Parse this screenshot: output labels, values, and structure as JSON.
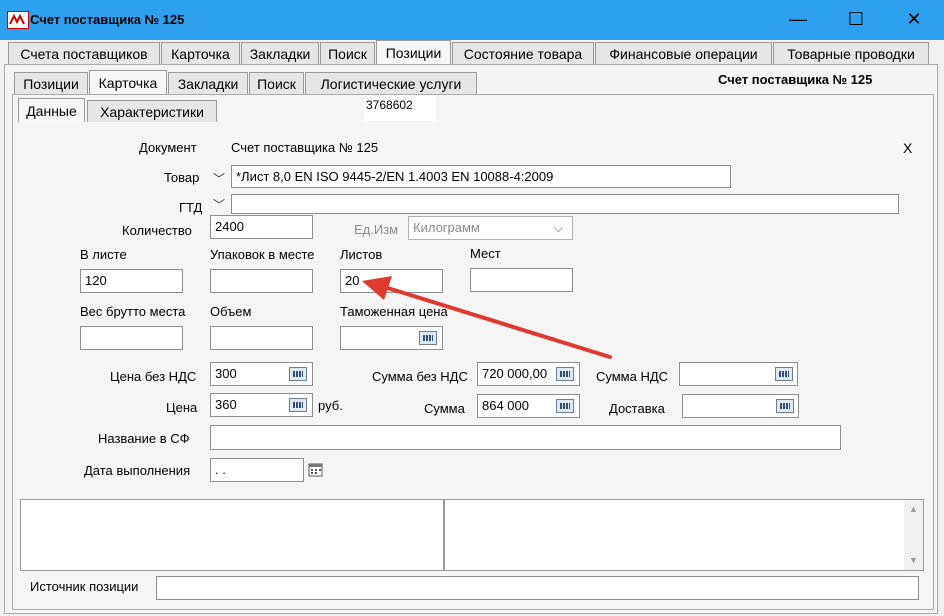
{
  "window": {
    "title": "Счет поставщика № 125",
    "minimize": "—",
    "maximize": "☐",
    "close": "✕"
  },
  "top_tabs": [
    "Счета поставщиков",
    "Карточка",
    "Закладки",
    "Поиск",
    "Позиции",
    "Состояние товара",
    "Финансовые операции",
    "Товарные проводки"
  ],
  "sub_tabs": [
    "Позиции",
    "Карточка",
    "Закладки",
    "Поиск",
    "Логистические услуги"
  ],
  "doc_header": "Счет поставщика № 125",
  "inner_tabs": [
    "Данные",
    "Характеристики"
  ],
  "code_value": "3768602",
  "form": {
    "document_label": "Документ",
    "document_value": "Счет поставщика № 125",
    "close_x": "X",
    "goods_label": "Товар",
    "goods_value": "*Лист 8,0 EN ISO 9445-2/EN 1.4003 EN 10088-4:2009",
    "gtd_label": "ГТД",
    "gtd_value": "",
    "quantity_label": "Количество",
    "quantity_value": "2400",
    "unit_label": "Ед.Изм",
    "unit_value": "Килограмм",
    "in_sheet_label": "В листе",
    "in_sheet_value": "120",
    "packages_label": "Упаковок в месте",
    "packages_value": "",
    "sheets_label": "Листов",
    "sheets_value": "20",
    "places_label": "Мест",
    "places_value": "",
    "gross_weight_label": "Вес брутто места",
    "gross_weight_value": "",
    "volume_label": "Объем",
    "volume_value": "",
    "customs_price_label": "Таможенная цена",
    "customs_price_value": "",
    "price_novat_label": "Цена без НДС",
    "price_novat_value": "300",
    "sum_novat_label": "Сумма без НДС",
    "sum_novat_value": "720 000,00",
    "vat_sum_label": "Сумма НДС",
    "vat_sum_value": "",
    "price_label": "Цена",
    "price_value": "360",
    "currency": "руб.",
    "sum_label": "Сумма",
    "sum_value": "864 000",
    "delivery_label": "Доставка",
    "delivery_value": "",
    "sf_name_label": "Название в СФ",
    "sf_name_value": "",
    "exec_date_label": "Дата выполнения",
    "exec_date_value": " .  .",
    "source_label": "Источник позиции",
    "source_value": ""
  },
  "colors": {
    "titlebar": "#2ea0f0",
    "arrow": "#e03a2e"
  }
}
